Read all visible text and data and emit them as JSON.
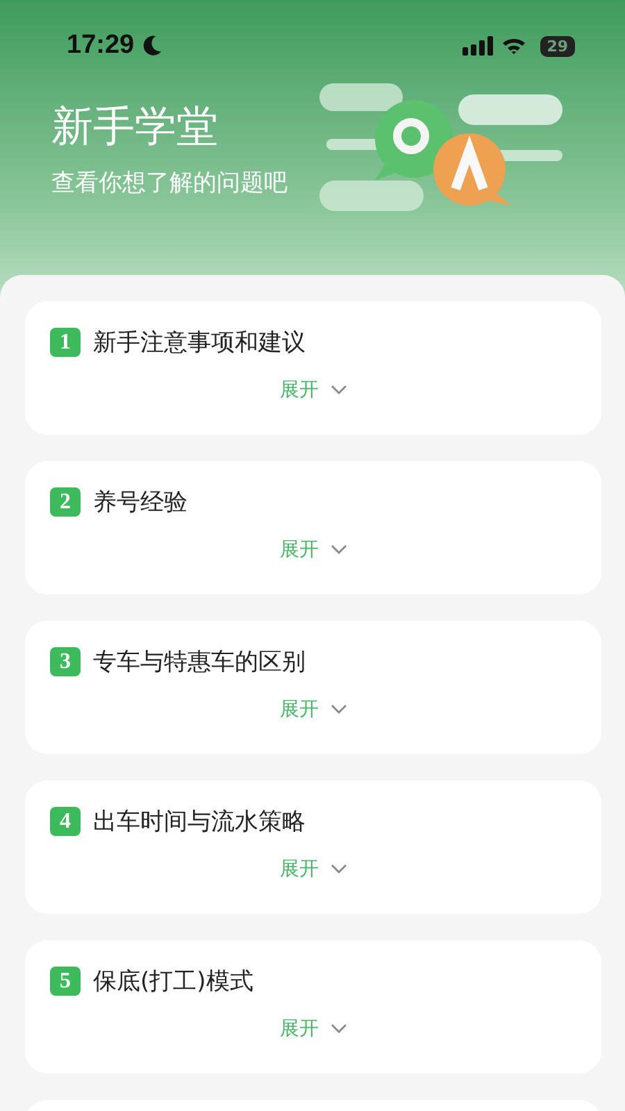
{
  "status_bar": {
    "time": "17:29",
    "battery": "29"
  },
  "header": {
    "title": "新手学堂",
    "subtitle": "查看你想了解的问题吧"
  },
  "questions": [
    {
      "number": "1",
      "title": "新手注意事项和建议",
      "toggle": "展开",
      "expanded": false
    },
    {
      "number": "2",
      "title": "养号经验",
      "toggle": "展开",
      "expanded": false
    },
    {
      "number": "3",
      "title": "专车与特惠车的区别",
      "toggle": "展开",
      "expanded": false
    },
    {
      "number": "4",
      "title": "出车时间与流水策略",
      "toggle": "展开",
      "expanded": false
    },
    {
      "number": "5",
      "title": "保底(打工)模式",
      "toggle": "展开",
      "expanded": false
    }
  ]
}
